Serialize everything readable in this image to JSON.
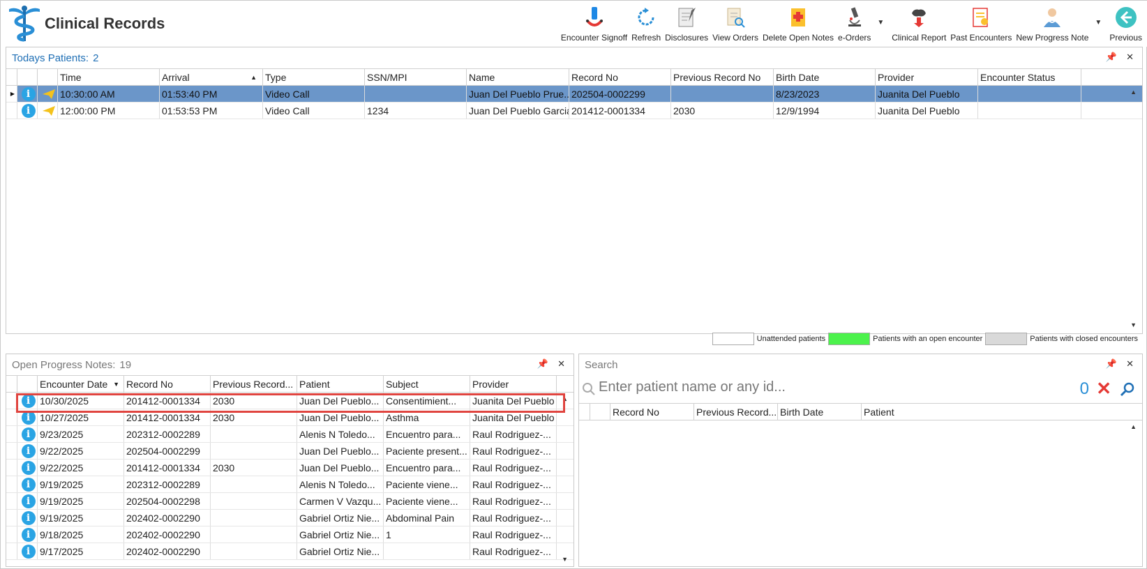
{
  "app": {
    "title": "Clinical Records"
  },
  "toolbar": [
    {
      "label": "Encounter Signoff",
      "icon": "signoff-icon"
    },
    {
      "label": "Refresh",
      "icon": "refresh-icon"
    },
    {
      "label": "Disclosures",
      "icon": "disclosures-icon"
    },
    {
      "label": "View Orders",
      "icon": "view-orders-icon"
    },
    {
      "label": "Delete Open Notes",
      "icon": "delete-notes-icon"
    },
    {
      "label": "e-Orders",
      "icon": "microscope-icon"
    },
    {
      "label": "Clinical Report",
      "icon": "clinical-report-icon"
    },
    {
      "label": "Past Encounters",
      "icon": "past-encounters-icon"
    },
    {
      "label": "New Progress Note",
      "icon": "doctor-icon"
    },
    {
      "label": "Previous",
      "icon": "back-arrow-icon"
    }
  ],
  "today": {
    "title": "Todays Patients:",
    "count": "2",
    "columns": [
      "Time",
      "Arrival",
      "Type",
      "SSN/MPI",
      "Name",
      "Record No",
      "Previous Record No",
      "Birth Date",
      "Provider",
      "Encounter Status"
    ],
    "rows": [
      {
        "time": "10:30:00 AM",
        "arrival": "01:53:40 PM",
        "type": "Video Call",
        "ssn": "",
        "name": "Juan Del Pueblo Prue...",
        "record": "202504-0002299",
        "prev": "",
        "birth": "8/23/2023",
        "provider": "Juanita Del Pueblo",
        "status": ""
      },
      {
        "time": "12:00:00 PM",
        "arrival": "01:53:53 PM",
        "type": "Video Call",
        "ssn": "1234",
        "name": "Juan Del Pueblo Garcia",
        "record": "201412-0001334",
        "prev": "2030",
        "birth": "12/9/1994",
        "provider": "Juanita Del Pueblo",
        "status": ""
      }
    ]
  },
  "legend": {
    "unattended": "Unattended patients",
    "open": "Patients with an open encounter",
    "closed": "Patients with closed encounters",
    "colors": {
      "unattended": "#ffffff",
      "open": "#4cf24c",
      "closed": "#d9d9d9"
    }
  },
  "notes": {
    "title": "Open Progress Notes:",
    "count": "19",
    "columns": [
      "Encounter Date",
      "Record No",
      "Previous Record...",
      "Patient",
      "Subject",
      "Provider"
    ],
    "rows": [
      {
        "date": "10/30/2025",
        "record": "201412-0001334",
        "prev": "2030",
        "patient": "Juan Del Pueblo...",
        "subject": "Consentimient...",
        "provider": "Juanita Del Pueblo"
      },
      {
        "date": "10/27/2025",
        "record": "201412-0001334",
        "prev": "2030",
        "patient": "Juan Del Pueblo...",
        "subject": "Asthma",
        "provider": "Juanita Del Pueblo"
      },
      {
        "date": "9/23/2025",
        "record": "202312-0002289",
        "prev": "",
        "patient": "Alenis N Toledo...",
        "subject": "Encuentro para...",
        "provider": "Raul Rodriguez-..."
      },
      {
        "date": "9/22/2025",
        "record": "202504-0002299",
        "prev": "",
        "patient": "Juan Del Pueblo...",
        "subject": "Paciente present...",
        "provider": "Raul Rodriguez-..."
      },
      {
        "date": "9/22/2025",
        "record": "201412-0001334",
        "prev": "2030",
        "patient": "Juan Del Pueblo...",
        "subject": "Encuentro para...",
        "provider": "Raul Rodriguez-..."
      },
      {
        "date": "9/19/2025",
        "record": "202312-0002289",
        "prev": "",
        "patient": "Alenis N Toledo...",
        "subject": "Paciente viene...",
        "provider": "Raul Rodriguez-..."
      },
      {
        "date": "9/19/2025",
        "record": "202504-0002298",
        "prev": "",
        "patient": "Carmen V Vazqu...",
        "subject": "Paciente viene...",
        "provider": "Raul Rodriguez-..."
      },
      {
        "date": "9/19/2025",
        "record": "202402-0002290",
        "prev": "",
        "patient": "Gabriel Ortiz Nie...",
        "subject": "Abdominal Pain",
        "provider": "Raul Rodriguez-..."
      },
      {
        "date": "9/18/2025",
        "record": "202402-0002290",
        "prev": "",
        "patient": "Gabriel Ortiz Nie...",
        "subject": "1",
        "provider": "Raul Rodriguez-..."
      },
      {
        "date": "9/17/2025",
        "record": "202402-0002290",
        "prev": "",
        "patient": "Gabriel Ortiz Nie...",
        "subject": "",
        "provider": "Raul Rodriguez-..."
      }
    ]
  },
  "search": {
    "title": "Search",
    "placeholder": "Enter patient name or any id...",
    "count": "0",
    "columns": [
      "Record No",
      "Previous Record...",
      "Birth Date",
      "Patient"
    ]
  }
}
